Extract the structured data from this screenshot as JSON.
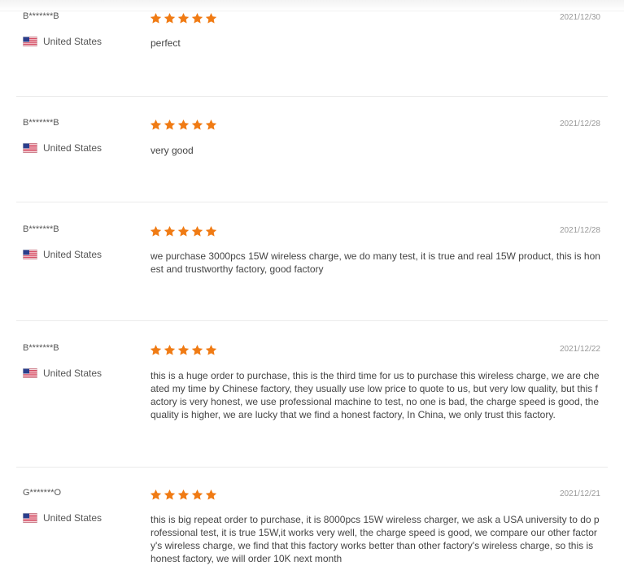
{
  "accent_color": "#f07b14",
  "flag_icon": "us-flag-icon",
  "star_icon": "star-icon",
  "reviews": [
    {
      "buyer": "B*******B",
      "country": "United States",
      "rating": 5,
      "date": "2021/12/30",
      "text": "perfect"
    },
    {
      "buyer": "B*******B",
      "country": "United States",
      "rating": 5,
      "date": "2021/12/28",
      "text": "very good"
    },
    {
      "buyer": "B*******B",
      "country": "United States",
      "rating": 5,
      "date": "2021/12/28",
      "text": "we purchase 3000pcs 15W wireless charge, we do many test, it is true and real 15W product, this is honest and trustworthy factory, good factory"
    },
    {
      "buyer": "B*******B",
      "country": "United States",
      "rating": 5,
      "date": "2021/12/22",
      "text": "this is a huge order to purchase, this is the third time for us to purchase this wireless charge, we are cheated my time by Chinese factory, they usually use low price to quote to us, but very low quality, but this factory is very honest, we use professional machine to test, no one is bad, the charge speed is good, the quality is higher, we are lucky that we find a honest factory, In China, we only trust this factory."
    },
    {
      "buyer": "G*******O",
      "country": "United States",
      "rating": 5,
      "date": "2021/12/21",
      "text": "this is big repeat order to purchase, it is 8000pcs 15W wireless charger, we ask a USA university to do professional test, it is true 15W,it works very well, the charge speed is good, we compare our other factory's wireless charge, we find that this factory works better than other factory's wireless charge, so this is honest factory, we will order 10K next month"
    }
  ]
}
